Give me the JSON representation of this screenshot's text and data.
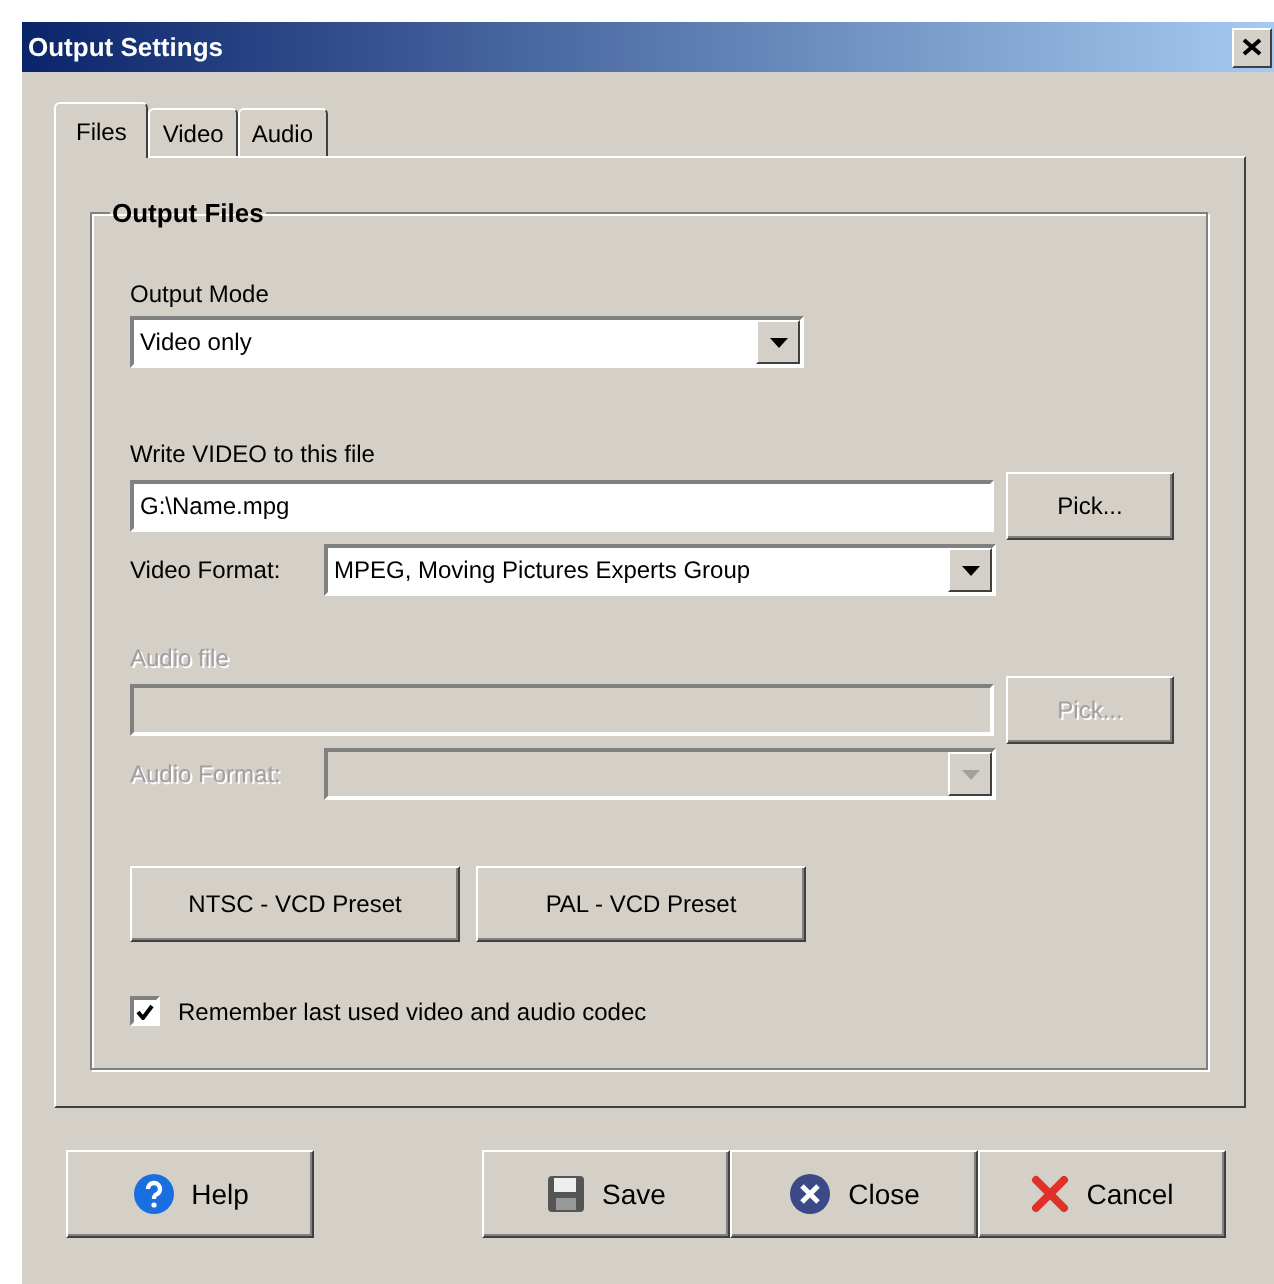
{
  "window": {
    "title": "Output Settings"
  },
  "tabs": [
    {
      "label": "Files",
      "selected": true
    },
    {
      "label": "Video",
      "selected": false
    },
    {
      "label": "Audio",
      "selected": false
    }
  ],
  "group": {
    "title": "Output Files"
  },
  "output_mode": {
    "label": "Output Mode",
    "value": "Video only"
  },
  "video_file": {
    "label": "Write VIDEO to this file",
    "value": "G:\\Name.mpg",
    "button": "Pick...",
    "disabled": false
  },
  "video_format": {
    "label": "Video Format:",
    "value": "MPEG, Moving Pictures Experts Group",
    "disabled": false
  },
  "audio_file": {
    "label": "Audio file",
    "button": "Pick...",
    "disabled": true
  },
  "audio_format": {
    "label": "Audio Format:",
    "disabled": true
  },
  "presets": [
    "NTSC - VCD Preset",
    "PAL - VCD Preset"
  ],
  "remember": {
    "label": "Remember last used video and audio codec",
    "checked": true
  },
  "buttons": [
    {
      "kind": "help",
      "label": "Help"
    },
    {
      "kind": "save",
      "label": "Save"
    },
    {
      "kind": "close",
      "label": "Close"
    },
    {
      "kind": "cancel",
      "label": "Cancel"
    }
  ]
}
